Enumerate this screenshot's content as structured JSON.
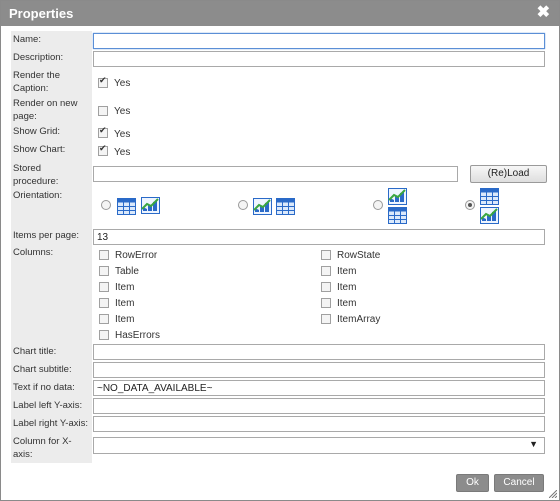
{
  "dialog": {
    "title": "Properties",
    "close_glyph": "✖"
  },
  "labels": {
    "name": "Name:",
    "description": "Description:",
    "render_caption": "Render the Caption:",
    "render_new_page": "Render on new page:",
    "show_grid": "Show Grid:",
    "show_chart": "Show Chart:",
    "stored_procedure": "Stored procedure:",
    "orientation": "Orientation:",
    "items_per_page": "Items per page:",
    "columns": "Columns:",
    "chart_title": "Chart title:",
    "chart_subtitle": "Chart subtitle:",
    "text_if_no_data": "Text if no data:",
    "label_left_y": "Label left Y-axis:",
    "label_right_y": "Label right Y-axis:",
    "column_for_x": "Column for X-axis:"
  },
  "fields": {
    "name": "",
    "description": "",
    "stored_procedure": "",
    "items_per_page": "13",
    "chart_title": "",
    "chart_subtitle": "",
    "text_if_no_data": "~NO_DATA_AVAILABLE~",
    "label_left_y": "",
    "label_right_y": "",
    "column_for_x": ""
  },
  "checkboxes": {
    "render_caption": {
      "label": "Yes",
      "checked": true
    },
    "render_new_page": {
      "label": "Yes",
      "checked": false
    },
    "show_grid": {
      "label": "Yes",
      "checked": true
    },
    "show_chart": {
      "label": "Yes",
      "checked": true
    }
  },
  "reload_button": "(Re)Load",
  "orientation": {
    "options": [
      "grid-left-chart-right",
      "chart-left-grid-right",
      "chart-top-grid-bottom",
      "grid-top-chart-bottom"
    ],
    "selected": 3,
    "icons": [
      "grid-icon",
      "chart-icon"
    ]
  },
  "columns": {
    "left": [
      "RowError",
      "Table",
      "Item",
      "Item",
      "Item",
      "HasErrors"
    ],
    "right": [
      "RowState",
      "Item",
      "Item",
      "Item",
      "ItemArray"
    ]
  },
  "buttons": {
    "ok": "Ok",
    "cancel": "Cancel"
  },
  "colors": {
    "titlebar": "#8c8c8c",
    "label_bg": "#ececec",
    "focus": "#5b8fd6"
  }
}
